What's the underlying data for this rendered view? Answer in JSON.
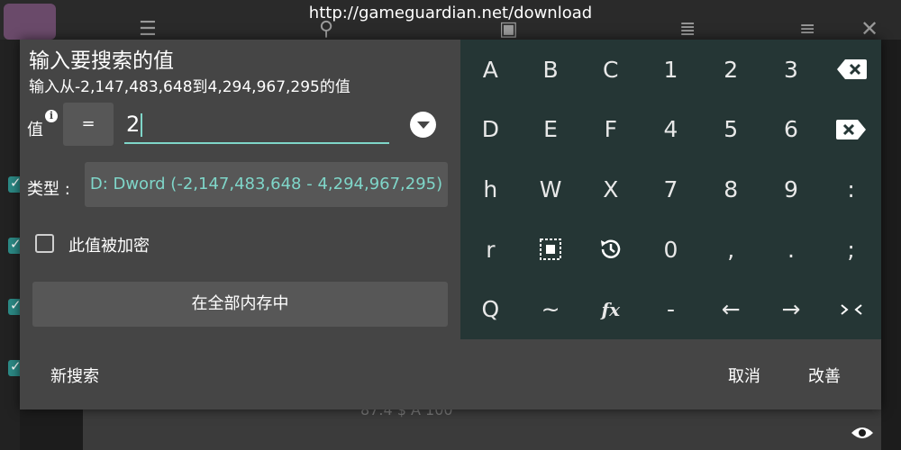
{
  "background": {
    "url": "http://gameguardian.net/download",
    "bottom_text": "87.4 $ A 100"
  },
  "dialog": {
    "title": "输入要搜索的值",
    "subtitle": "输入从-2,147,483,648到4,294,967,295的值",
    "value_label": "值",
    "info": "i",
    "operator": "=",
    "value": "2",
    "type_label": "类型 :",
    "type_value": "D: Dword (-2,147,483,648 - 4,294,967,295)",
    "encrypted_label": "此值被加密",
    "memory_button": "在全部内存中",
    "new_search": "新搜索",
    "cancel": "取消",
    "refine": "改善"
  },
  "keyboard": {
    "keys": [
      {
        "label": "A",
        "icon": null
      },
      {
        "label": "B",
        "icon": null
      },
      {
        "label": "C",
        "icon": null
      },
      {
        "label": "1",
        "icon": null
      },
      {
        "label": "2",
        "icon": null
      },
      {
        "label": "3",
        "icon": null
      },
      {
        "label": "",
        "icon": "backspace-icon"
      },
      {
        "label": "D",
        "icon": null
      },
      {
        "label": "E",
        "icon": null
      },
      {
        "label": "F",
        "icon": null
      },
      {
        "label": "4",
        "icon": null
      },
      {
        "label": "5",
        "icon": null
      },
      {
        "label": "6",
        "icon": null
      },
      {
        "label": "",
        "icon": "delete-icon"
      },
      {
        "label": "h",
        "icon": null
      },
      {
        "label": "W",
        "icon": null
      },
      {
        "label": "X",
        "icon": null
      },
      {
        "label": "7",
        "icon": null
      },
      {
        "label": "8",
        "icon": null
      },
      {
        "label": "9",
        "icon": null
      },
      {
        "label": ":",
        "icon": null
      },
      {
        "label": "r",
        "icon": null
      },
      {
        "label": "",
        "icon": "select-all-icon"
      },
      {
        "label": "",
        "icon": "history-icon"
      },
      {
        "label": "0",
        "icon": null
      },
      {
        "label": ",",
        "icon": null
      },
      {
        "label": ".",
        "icon": null
      },
      {
        "label": ";",
        "icon": null
      },
      {
        "label": "Q",
        "icon": null
      },
      {
        "label": "~",
        "icon": null
      },
      {
        "label": "fx",
        "icon": null
      },
      {
        "label": "-",
        "icon": null
      },
      {
        "label": "←",
        "icon": null
      },
      {
        "label": "→",
        "icon": null
      },
      {
        "label": "",
        "icon": "collapse-icon"
      }
    ]
  },
  "colors": {
    "accent": "#7fd6c9",
    "dialog_bg": "#454545",
    "keyboard_bg": "#253635"
  }
}
